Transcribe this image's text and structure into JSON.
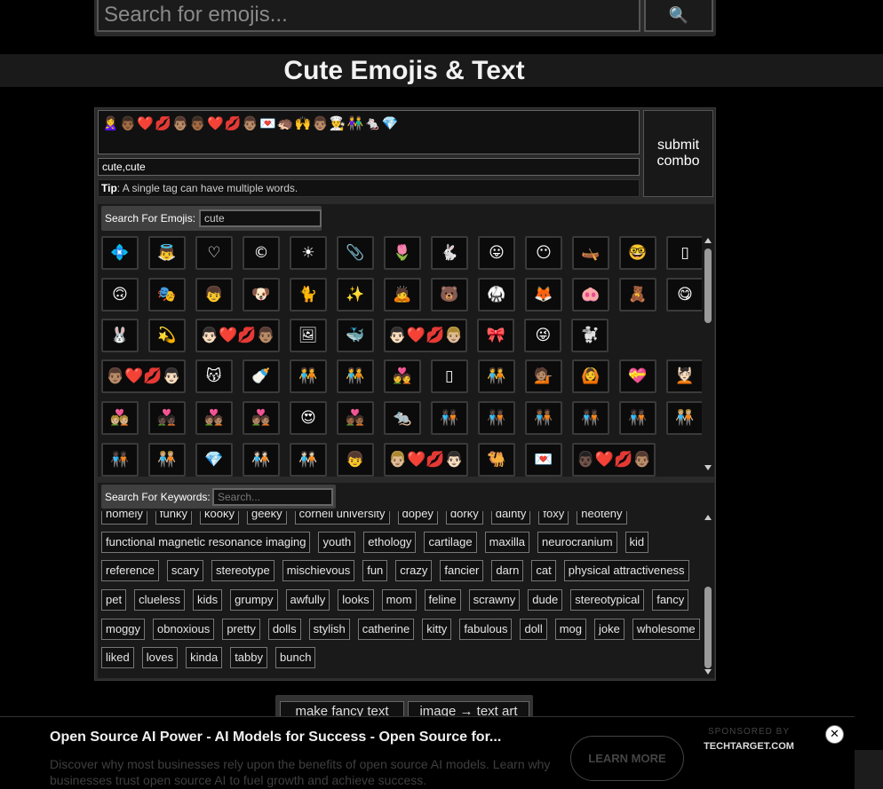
{
  "search": {
    "placeholder": "Search for emojis...",
    "button_icon": "🔍"
  },
  "page_title": "Cute Emojis & Text",
  "combo": {
    "emojis": "🙎‍♀️👨🏾❤️💋👨🏽👨🏾❤️💋👨🏽💌🦔🙌👨🏽👨‍🍳👫🐁💎",
    "tags_value": "cute,cute",
    "tip_label": "Tip",
    "tip_text": ": A single tag can have multiple words.",
    "submit_label": "submit combo"
  },
  "emoji_search": {
    "label": "Search For Emojis:",
    "value": "cute"
  },
  "emoji_rows": [
    [
      "💠",
      "👼",
      "♡",
      "©",
      "☀",
      "📎",
      "🌷",
      "🐇",
      "😛",
      "😶",
      "🛶",
      "🤓",
      "▯",
      "🐱"
    ],
    [
      "🙃",
      "🎭",
      "👦",
      "🐶",
      "🐈",
      "✨",
      "🙇",
      "🐻",
      "🥋",
      "🦊",
      "🐽",
      "🧸",
      "😋"
    ],
    [
      "🐰",
      "💫",
      "👨🏻❤️💋👨🏽",
      "🖼",
      "🐳",
      "👨🏻❤️💋👨🏼",
      "🎀",
      "😜",
      "🐩"
    ],
    [
      "👨🏽❤️💋👨🏻",
      "😽",
      "🍼",
      "🧑‍🤝‍🧑",
      "🧑‍🤝‍🧑",
      "💑",
      "▯",
      "🧑‍🤝‍🧑",
      "💁🏽",
      "🙆",
      "💝",
      "💆🏻"
    ],
    [
      "💑🏼",
      "💑🏿",
      "💑🏽",
      "💑🏽",
      "😍",
      "💑🏾",
      "🐀",
      "🧑🏿‍🤝‍🧑🏿",
      "🧑🏿‍🤝‍🧑🏿",
      "🧑🏾‍🤝‍🧑🏾",
      "🧑🏿‍🤝‍🧑🏿",
      "🧑🏿‍🤝‍🧑🏿",
      "🧑🏼‍🤝‍🧑🏼"
    ],
    [
      "🧑🏿‍🤝‍🧑🏿",
      "🧑🏼‍🤝‍🧑🏼",
      "💎",
      "🧑🏻‍🤝‍🧑🏻",
      "🧑🏻‍🤝‍🧑🏻",
      "👦",
      "👨🏼❤️💋👨🏻",
      "🐫",
      "💌",
      "👨🏿❤️💋👨🏽"
    ]
  ],
  "keyword_search": {
    "label": "Search For Keywords:",
    "placeholder": "Search..."
  },
  "keyword_rows": [
    [
      "homely",
      "funky",
      "kooky",
      "geeky",
      "cornell university",
      "dopey",
      "dorky",
      "dainty",
      "foxy",
      "neoteny"
    ],
    [
      "functional magnetic resonance imaging",
      "youth",
      "ethology",
      "cartilage",
      "maxilla",
      "neurocranium",
      "kid"
    ],
    [
      "reference",
      "scary",
      "stereotype",
      "mischievous",
      "fun",
      "crazy",
      "fancier",
      "darn",
      "cat",
      "physical attractiveness"
    ],
    [
      "pet",
      "clueless",
      "kids",
      "grumpy",
      "awfully",
      "looks",
      "mom",
      "feline",
      "scrawny",
      "dude",
      "stereotypical",
      "fancy"
    ],
    [
      "moggy",
      "obnoxious",
      "pretty",
      "dolls",
      "stylish",
      "catherine",
      "kitty",
      "fabulous",
      "doll",
      "mog",
      "joke",
      "wholesome"
    ],
    [
      "liked",
      "loves",
      "kinda",
      "tabby",
      "bunch"
    ]
  ],
  "bottom_tabs": [
    "make fancy text",
    "image → text art"
  ],
  "ad": {
    "title": "Open Source AI Power - AI Models for Success - Open Source for...",
    "description": "Discover why most businesses rely upon the benefits of open source AI models. Learn why businesses trust open source AI to fuel growth and achieve success.",
    "cta": "LEARN MORE",
    "sponsored_label": "SPONSORED BY",
    "brand": "TECHTARGET.COM",
    "close_icon": "✕"
  }
}
